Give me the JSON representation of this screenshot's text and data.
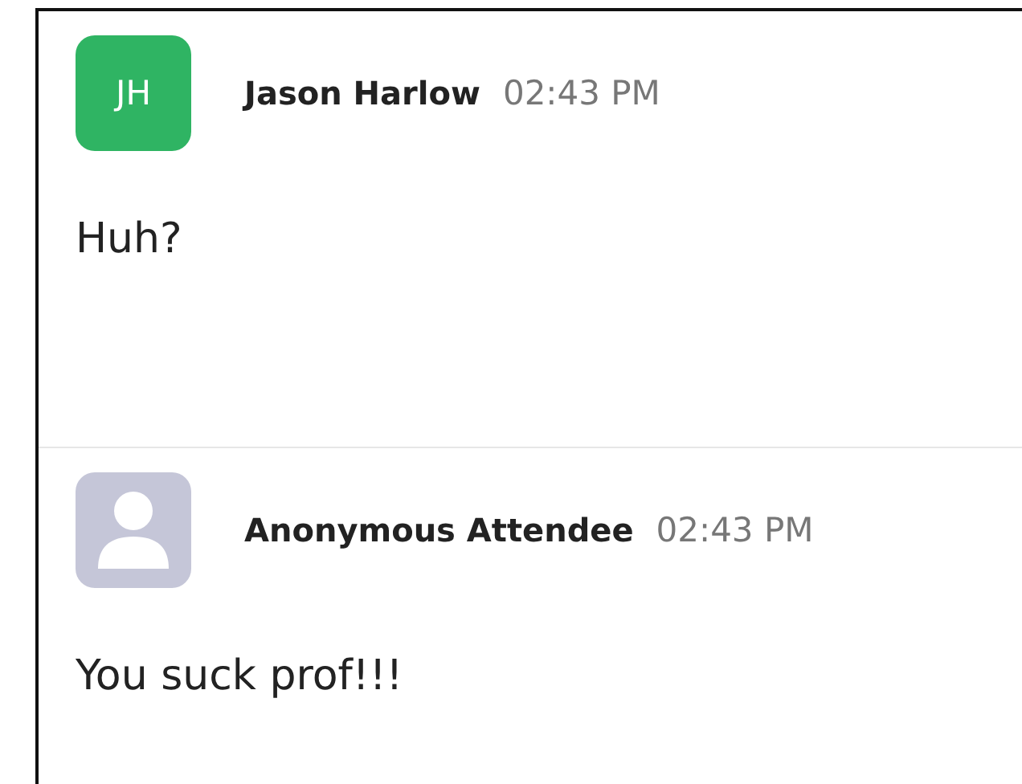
{
  "messages": [
    {
      "avatar": {
        "kind": "initials",
        "initials": "JH",
        "color": "#2fb463"
      },
      "sender": "Jason Harlow",
      "time": "02:43 PM",
      "text": "Huh?"
    },
    {
      "avatar": {
        "kind": "silhouette",
        "color": "#c5c6d8"
      },
      "sender": "Anonymous Attendee",
      "time": "02:43 PM",
      "text": "You suck prof!!!"
    }
  ]
}
